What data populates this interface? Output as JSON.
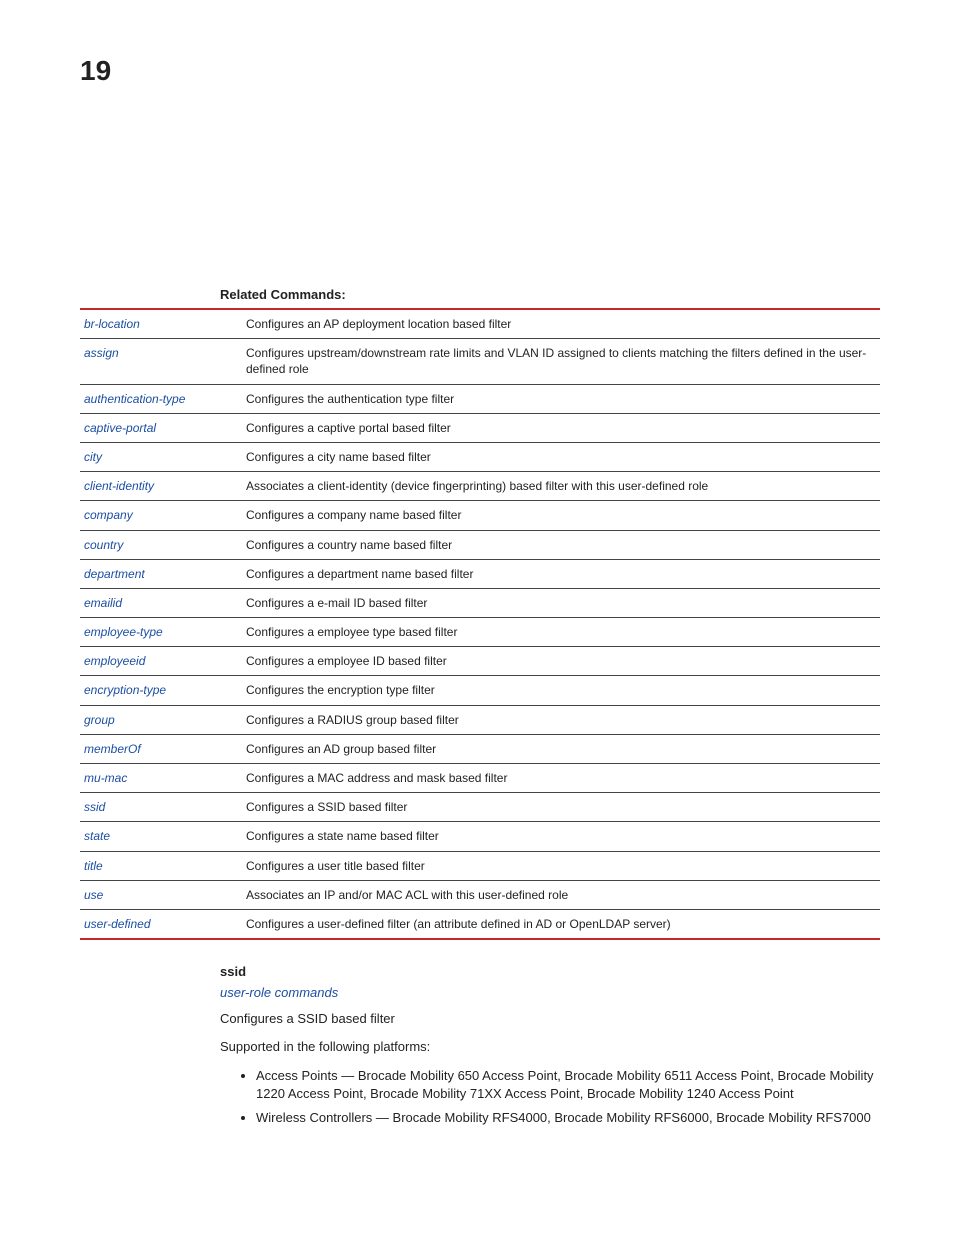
{
  "page_number": "19",
  "related_heading": "Related Commands:",
  "rows": [
    {
      "k": "br-location",
      "v": "Configures an AP deployment location based filter"
    },
    {
      "k": "assign",
      "v": "Configures upstream/downstream rate limits and VLAN ID assigned to clients matching the filters defined in the user-defined role"
    },
    {
      "k": "authentication-type",
      "v": "Configures the authentication type filter"
    },
    {
      "k": "captive-portal",
      "v": "Configures a captive portal based filter"
    },
    {
      "k": "city",
      "v": "Configures a city name based filter"
    },
    {
      "k": "client-identity",
      "v": "Associates a client-identity (device fingerprinting) based filter with this user-defined role"
    },
    {
      "k": "company",
      "v": "Configures a company name based filter"
    },
    {
      "k": "country",
      "v": "Configures a country name based filter"
    },
    {
      "k": "department",
      "v": "Configures a department name based filter"
    },
    {
      "k": "emailid",
      "v": "Configures a e-mail ID based filter"
    },
    {
      "k": "employee-type",
      "v": "Configures a employee type based filter"
    },
    {
      "k": "employeeid",
      "v": "Configures a employee ID based filter"
    },
    {
      "k": "encryption-type",
      "v": "Configures the encryption type filter"
    },
    {
      "k": "group",
      "v": "Configures a RADIUS group based filter"
    },
    {
      "k": "memberOf",
      "v": "Configures an AD group based filter"
    },
    {
      "k": "mu-mac",
      "v": "Configures a MAC address and mask based filter"
    },
    {
      "k": "ssid",
      "v": "Configures a SSID based filter"
    },
    {
      "k": "state",
      "v": "Configures a state name based filter"
    },
    {
      "k": "title",
      "v": "Configures a user title based filter"
    },
    {
      "k": "use",
      "v": "Associates an IP and/or MAC ACL with this user-defined role"
    },
    {
      "k": "user-defined",
      "v": "Configures a user-defined filter (an attribute defined in AD or OpenLDAP server)"
    }
  ],
  "ssid_section": {
    "title": "ssid",
    "subsection": "user-role commands",
    "desc": "Configures a SSID based filter",
    "supported": "Supported in the following platforms:",
    "bullets": [
      "Access Points — Brocade Mobility 650 Access Point, Brocade Mobility 6511 Access Point, Brocade Mobility 1220 Access Point, Brocade Mobility 71XX Access Point, Brocade Mobility 1240 Access Point",
      "Wireless Controllers — Brocade Mobility RFS4000, Brocade Mobility RFS6000, Brocade Mobility RFS7000"
    ]
  }
}
